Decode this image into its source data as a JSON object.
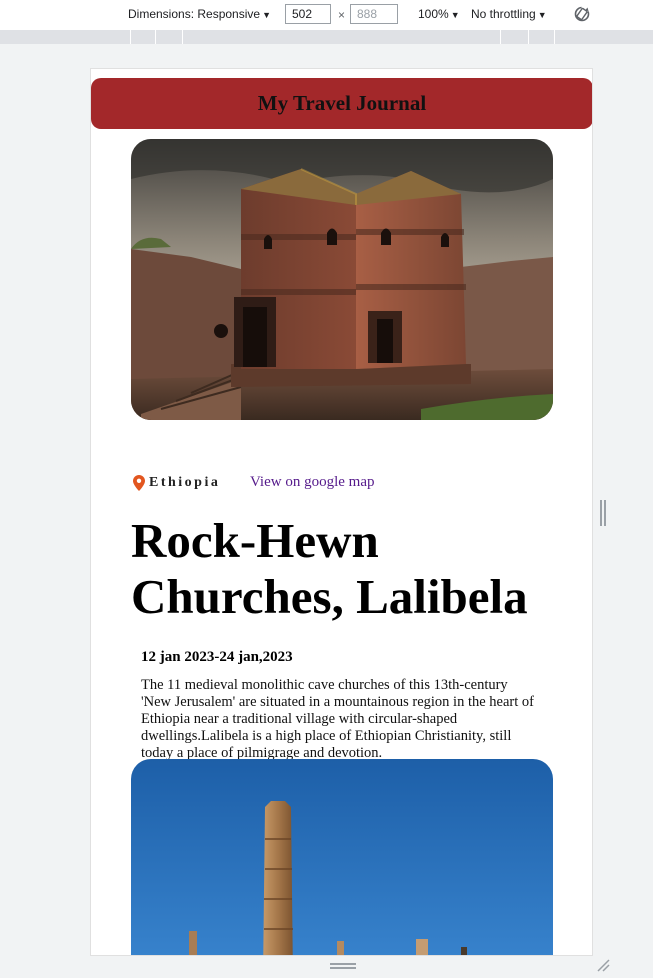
{
  "devtools": {
    "dimensions_label": "Dimensions: Responsive",
    "width_value": "502",
    "height_placeholder": "888",
    "times": "×",
    "zoom": "100%",
    "throttling": "No throttling"
  },
  "page": {
    "header_title": "My Travel Journal",
    "entries": [
      {
        "country": "Ethiopia",
        "map_link": "View on google map",
        "title": "Rock-Hewn Churches, Lalibela",
        "dates": "12 jan 2023-24 jan,2023",
        "description": "The 11 medieval monolithic cave churches of this 13th-century 'New Jerusalem' are situated in a mountainous region in the heart of Ethiopia near a traditional village with circular-shaped dwellings.Lalibela is a high place of Ethiopian Christianity, still today a place of pilmigrage and devotion."
      }
    ]
  },
  "icons": [
    "chevron-down-icon",
    "rotate-icon",
    "location-pin-icon",
    "resize-grip-icon"
  ],
  "colors": {
    "header_bg": "#a3282a",
    "pin": "#e2561f",
    "link": "#551a8b"
  }
}
